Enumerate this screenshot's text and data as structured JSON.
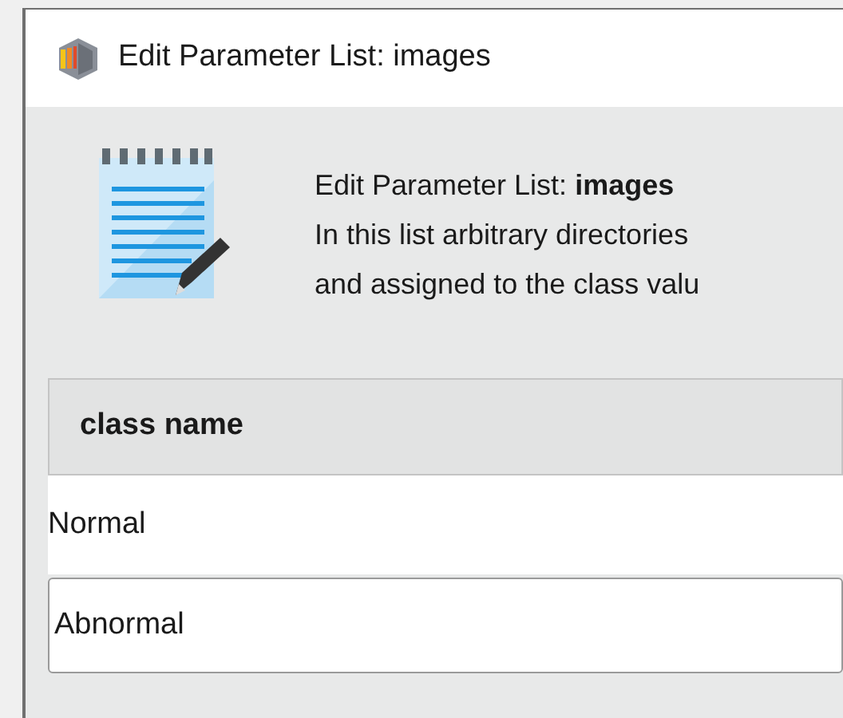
{
  "window": {
    "title": "Edit Parameter List: images"
  },
  "header": {
    "lines": [
      "Edit Parameter List: **images**",
      "In this list arbitrary directories",
      "and assigned to the class valu"
    ]
  },
  "table": {
    "columns": [
      "class name"
    ],
    "rows": [
      {
        "cells": [
          "Normal"
        ],
        "editing": false
      },
      {
        "cells": [
          "Abnormal"
        ],
        "editing": true
      }
    ]
  }
}
